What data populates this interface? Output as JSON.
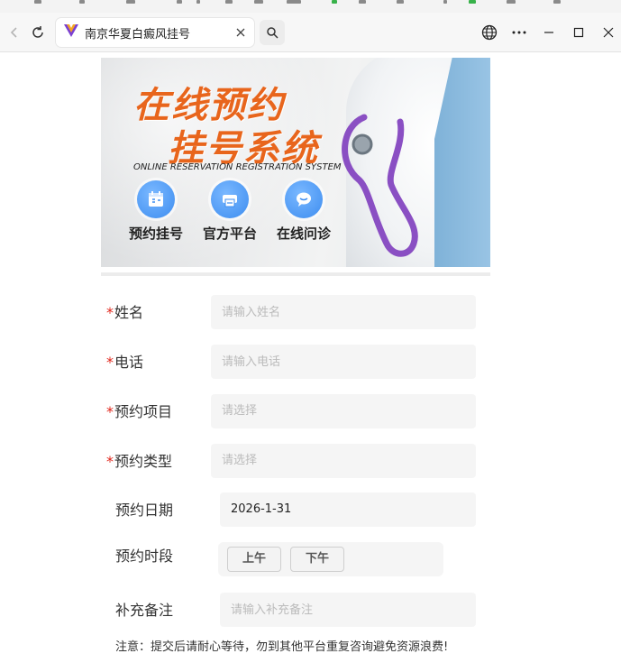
{
  "browser": {
    "tab_title": "南京华夏白癜风挂号",
    "icons": [
      "back-icon",
      "refresh-icon",
      "site-logo-icon",
      "close-icon",
      "search-icon",
      "globe-icon",
      "more-icon",
      "minimize-icon",
      "maximize-icon",
      "window-close-icon"
    ]
  },
  "banner": {
    "title_line1": "在线预约",
    "title_line2": "挂号系统",
    "subtitle": "ONLINE RESERVATION REGISTRATION SYSTEM",
    "features": [
      {
        "label": "预约挂号",
        "icon": "calendar-icon"
      },
      {
        "label": "官方平台",
        "icon": "printer-icon"
      },
      {
        "label": "在线问诊",
        "icon": "chat-icon"
      }
    ],
    "colors": {
      "title": "#e8651c",
      "feature_circle": "#3d8df0"
    }
  },
  "form": {
    "required_mark": "*",
    "name": {
      "label": "姓名",
      "placeholder": "请输入姓名"
    },
    "phone": {
      "label": "电话",
      "placeholder": "请输入电话"
    },
    "project": {
      "label": "预约项目",
      "placeholder": "请选择"
    },
    "type": {
      "label": "预约类型",
      "placeholder": "请选择"
    },
    "date": {
      "label": "预约日期",
      "value": "2026-1-31"
    },
    "timeslot": {
      "label": "预约时段",
      "options": [
        "上午",
        "下午"
      ]
    },
    "remark": {
      "label": "补充备注",
      "placeholder": "请输入补充备注"
    },
    "notice": "注意：提交后请耐心等待，勿到其他平台重复咨询避免资源浪费!"
  },
  "colors": {
    "required": "#e1251b",
    "field_bg": "#f5f5f5"
  }
}
